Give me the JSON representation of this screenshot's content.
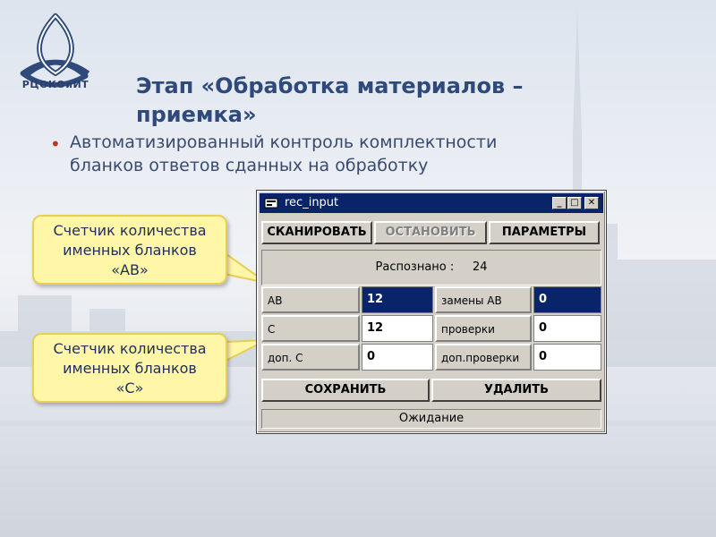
{
  "logo": {
    "text": "РЦОКОиИТ",
    "icon": "triquetra-logo-icon"
  },
  "slide": {
    "title_line1": "Этап «Обработка материалов –",
    "title_line2": "приемка»",
    "bullet_line1": "Автоматизированный контроль комплектности",
    "bullet_line2": "бланков ответов сданных на обработку"
  },
  "callouts": [
    {
      "line1": "Счетчик количества",
      "line2": "именных бланков",
      "line3": "«АВ»"
    },
    {
      "line1": "Счетчик количества",
      "line2": "именных бланков",
      "line3": "«С»"
    }
  ],
  "window": {
    "title": "rec_input",
    "minimize": "_",
    "maximize": "□",
    "close": "✕",
    "buttons": {
      "scan": "СКАНИРОВАТЬ",
      "stop": "ОСТАНОВИТЬ",
      "params": "ПАРАМЕТРЫ"
    },
    "recognized_label": "Распознано :",
    "recognized_value": "24",
    "rows": [
      {
        "left_label": "АВ",
        "left_value": "12",
        "right_label": "замены АВ",
        "right_value": "0"
      },
      {
        "left_label": "С",
        "left_value": "12",
        "right_label": "проверки",
        "right_value": "0"
      },
      {
        "left_label": "доп.  С",
        "left_value": "0",
        "right_label": "доп.проверки",
        "right_value": "0"
      }
    ],
    "save": "СОХРАНИТЬ",
    "delete": "УДАЛИТЬ",
    "status": "Ожидание"
  },
  "colors": {
    "title": "#2f4a7a",
    "bullet": "#c8331e",
    "callout_fill": "#fff6a8",
    "window_title_bar": "#0a246a"
  }
}
